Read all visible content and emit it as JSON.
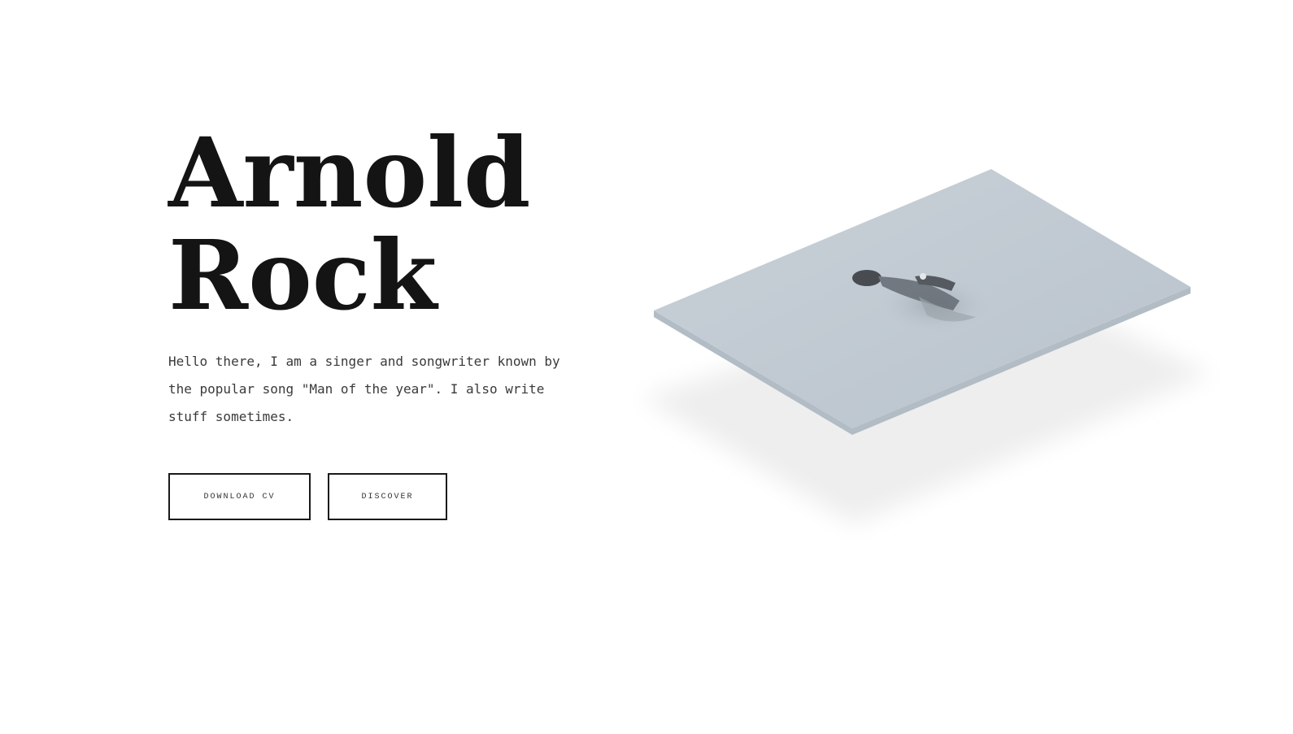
{
  "hero": {
    "title_line1": "Arnold",
    "title_line2": "Rock",
    "intro": "Hello there, I am a singer and songwriter known by the popular song \"Man of the year\". I also write stuff sometimes."
  },
  "actions": {
    "download_cv_label": "DOWNLOAD CV",
    "discover_label": "DISCOVER"
  },
  "photo": {
    "subject": "person in mist, monochrome blue-grey",
    "card_color": "#c3ccd4",
    "shadow_color": "#efefef"
  }
}
